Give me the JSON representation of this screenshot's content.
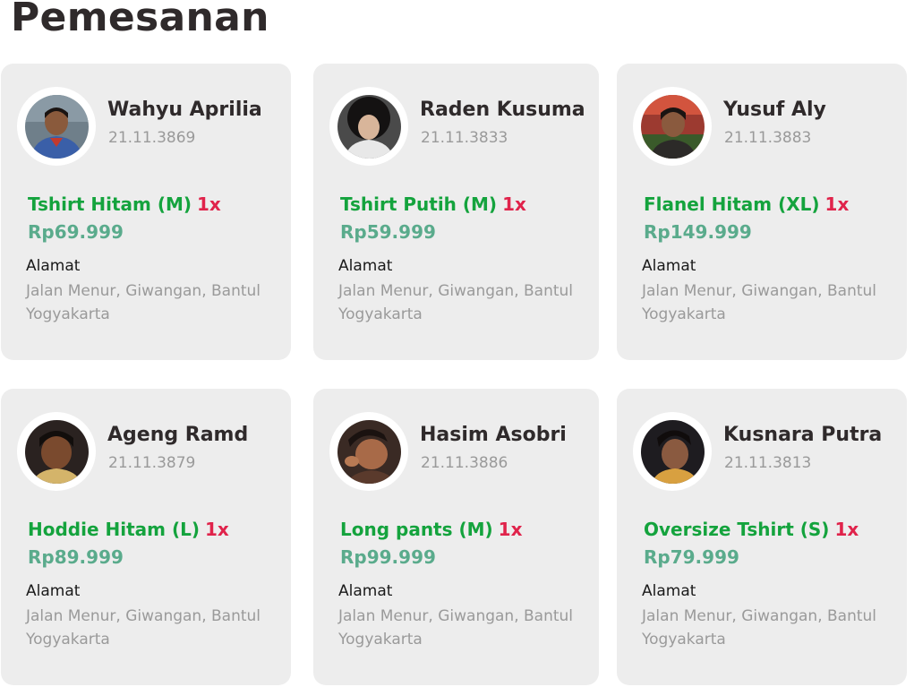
{
  "page": {
    "title": "Pemesanan"
  },
  "labels": {
    "address": "Alamat"
  },
  "colors": {
    "card_bg": "#ededed",
    "product": "#14a33d",
    "quantity": "#e0234b",
    "price": "#5aab8c",
    "muted": "#9a9a9a"
  },
  "orders": [
    {
      "name": "Wahyu Aprilia",
      "id": "21.11.3869",
      "product": "Tshirt Hitam (M)",
      "qty": "1x",
      "price": "Rp69.999",
      "address": "Jalan Menur, Giwangan, Bantul Yogyakarta",
      "avatar": "profile-photo"
    },
    {
      "name": "Raden Kusuma",
      "id": "21.11.3833",
      "product": "Tshirt Putih (M)",
      "qty": "1x",
      "price": "Rp59.999",
      "address": "Jalan Menur, Giwangan, Bantul Yogyakarta",
      "avatar": "profile-photo"
    },
    {
      "name": "Yusuf Aly",
      "id": "21.11.3883",
      "product": "Flanel Hitam (XL)",
      "qty": "1x",
      "price": "Rp149.999",
      "address": "Jalan Menur, Giwangan, Bantul Yogyakarta",
      "avatar": "profile-photo"
    },
    {
      "name": "Ageng Ramd",
      "id": "21.11.3879",
      "product": "Hoddie Hitam (L)",
      "qty": "1x",
      "price": "Rp89.999",
      "address": "Jalan Menur, Giwangan, Bantul Yogyakarta",
      "avatar": "profile-photo"
    },
    {
      "name": "Hasim Asobri",
      "id": "21.11.3886",
      "product": "Long pants (M)",
      "qty": "1x",
      "price": "Rp99.999",
      "address": "Jalan Menur, Giwangan, Bantul Yogyakarta",
      "avatar": "profile-photo"
    },
    {
      "name": "Kusnara Putra",
      "id": "21.11.3813",
      "product": "Oversize Tshirt (S)",
      "qty": "1x",
      "price": "Rp79.999",
      "address": "Jalan Menur, Giwangan, Bantul Yogyakarta",
      "avatar": "profile-photo"
    }
  ]
}
